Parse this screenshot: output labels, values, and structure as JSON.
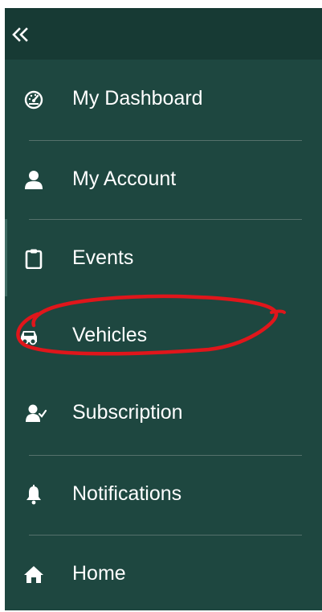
{
  "sidebar": {
    "collapse_icon": "double-chevron-left-icon",
    "items": [
      {
        "label": "My Dashboard",
        "icon": "dashboard-gauge-icon"
      },
      {
        "label": "My Account",
        "icon": "user-icon"
      },
      {
        "label": "Events",
        "icon": "clipboard-icon"
      },
      {
        "label": "Vehicles",
        "icon": "car-icon"
      },
      {
        "label": "Subscription",
        "icon": "user-check-icon"
      },
      {
        "label": "Notifications",
        "icon": "bell-icon"
      },
      {
        "label": "Home",
        "icon": "home-icon"
      }
    ],
    "active_item": "Events"
  },
  "colors": {
    "sidebar_bg": "#1e4740",
    "topbar_bg": "#173a34",
    "text": "#ffffff",
    "divider": "#55716b",
    "annotation": "#e0161b"
  }
}
